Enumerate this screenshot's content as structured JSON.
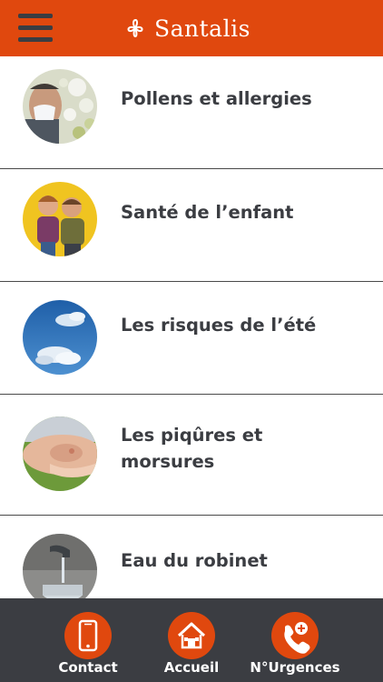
{
  "header": {
    "brand_name": "Santalis",
    "menu_icon": "hamburger-menu-icon",
    "logo_icon": "santalis-flower-logo",
    "background_color": "#e0480e"
  },
  "list": {
    "items": [
      {
        "label": "Pollens et allergies",
        "image": "person-sneezing-with-tissue-photo"
      },
      {
        "label": "Santé de l’enfant",
        "image": "two-children-photo"
      },
      {
        "label": "Les risques de l’été",
        "image": "blue-sky-clouds-photo"
      },
      {
        "label_lines": [
          "Les piqûres et",
          "morsures"
        ],
        "image": "skin-bite-photo"
      },
      {
        "label": "Eau du robinet",
        "image": "tap-water-glass-photo"
      }
    ]
  },
  "footer": {
    "background_color": "#3b3d42",
    "accent_color": "#e0480e",
    "buttons": [
      {
        "label": "Contact",
        "icon": "mobile-phone-icon"
      },
      {
        "label": "Accueil",
        "icon": "home-icon"
      },
      {
        "label": "N°Urgences",
        "icon": "phone-plus-icon"
      }
    ]
  }
}
